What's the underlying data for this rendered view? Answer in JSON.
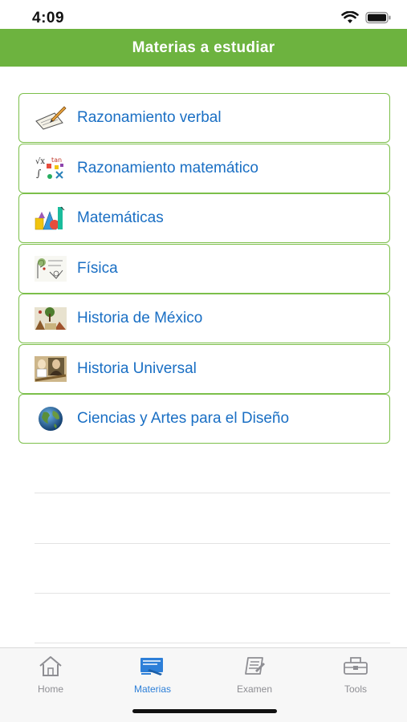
{
  "status": {
    "time": "4:09"
  },
  "header": {
    "title": "Materias a estudiar"
  },
  "subjects": [
    {
      "label": "Razonamiento verbal",
      "icon": "pen-paper-icon"
    },
    {
      "label": "Razonamiento matemático",
      "icon": "math-formulas-icon"
    },
    {
      "label": "Matemáticas",
      "icon": "geometric-shapes-icon"
    },
    {
      "label": "Física",
      "icon": "physics-sketch-icon"
    },
    {
      "label": "Historia de México",
      "icon": "mexico-history-icon"
    },
    {
      "label": "Historia Universal",
      "icon": "world-history-icon"
    },
    {
      "label": "Ciencias y Artes para el Diseño",
      "icon": "globe-icon"
    }
  ],
  "tabs": [
    {
      "label": "Home",
      "icon": "home-icon",
      "active": false
    },
    {
      "label": "Materias",
      "icon": "materias-icon",
      "active": true
    },
    {
      "label": "Examen",
      "icon": "exam-icon",
      "active": false
    },
    {
      "label": "Tools",
      "icon": "tools-icon",
      "active": false
    }
  ],
  "colors": {
    "header": "#6db33f",
    "border": "#7cbf4a",
    "link": "#1a6fc4",
    "active_tab": "#2d7fd8",
    "inactive_tab": "#8e8e93"
  }
}
